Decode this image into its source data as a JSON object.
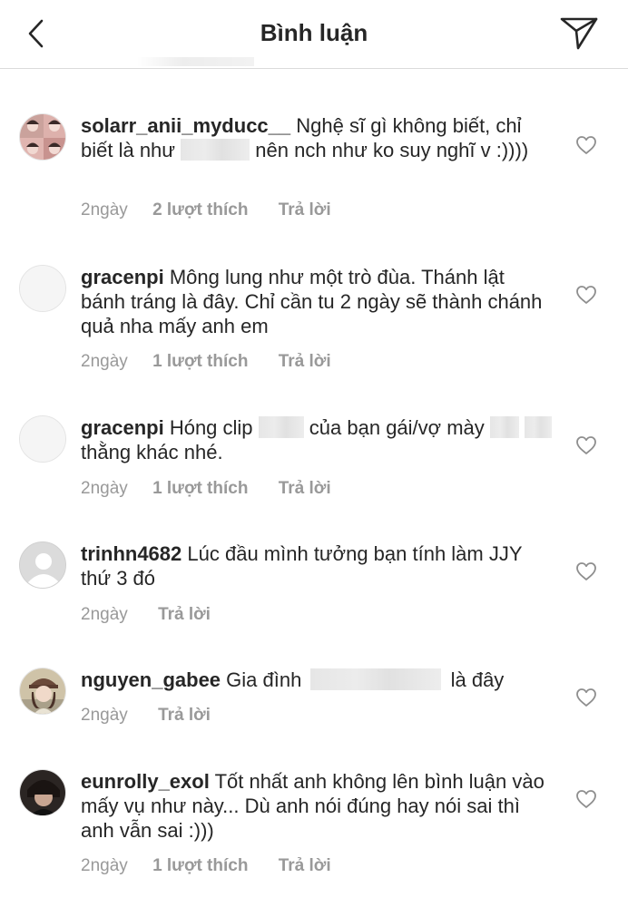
{
  "header": {
    "title": "Bình luận",
    "back_icon": "chevron-left-icon",
    "send_icon": "paper-plane-icon"
  },
  "colors": {
    "text": "#262626",
    "meta": "#999999",
    "divider": "#dbdbdb"
  },
  "comments": [
    {
      "username": "solarr_anii_myducc__",
      "text_parts": [
        "Nghệ sĩ gì không biết, chỉ biết là như",
        "nên nch như ko suy nghĩ v :))))"
      ],
      "time": "2ngày",
      "likes": "2 lượt thích",
      "reply": "Trả lời",
      "avatar": "photo-collage"
    },
    {
      "username": "gracenpi",
      "text_parts": [
        "Mông lung như một trò đùa. Thánh lật bánh tráng là đây. Chỉ cần tu 2 ngày sẽ thành chánh quả nha mấy anh em"
      ],
      "time": "2ngày",
      "likes": "1 lượt thích",
      "reply": "Trả lời",
      "avatar": "blank"
    },
    {
      "username": "gracenpi",
      "text_parts": [
        "Hóng clip",
        "của bạn gái/vợ mày",
        "thằng khác nhé."
      ],
      "time": "2ngày",
      "likes": "1 lượt thích",
      "reply": "Trả lời",
      "avatar": "blank"
    },
    {
      "username": "trinhn4682",
      "text_parts": [
        "Lúc đầu mình tưởng bạn tính làm JJY thứ 3 đó"
      ],
      "time": "2ngày",
      "likes": "",
      "reply": "Trả lời",
      "avatar": "default-person"
    },
    {
      "username": "nguyen_gabee",
      "text_parts": [
        "Gia đình",
        "là đây"
      ],
      "time": "2ngày",
      "likes": "",
      "reply": "Trả lời",
      "avatar": "photo-girl"
    },
    {
      "username": "eunrolly_exol",
      "text_parts": [
        "Tốt nhất anh không lên bình luận vào mấy vụ như này... Dù anh nói đúng hay nói sai thì anh vẫn sai :)))"
      ],
      "time": "2ngày",
      "likes": "1 lượt thích",
      "reply": "Trả lời",
      "avatar": "photo-dark"
    }
  ]
}
